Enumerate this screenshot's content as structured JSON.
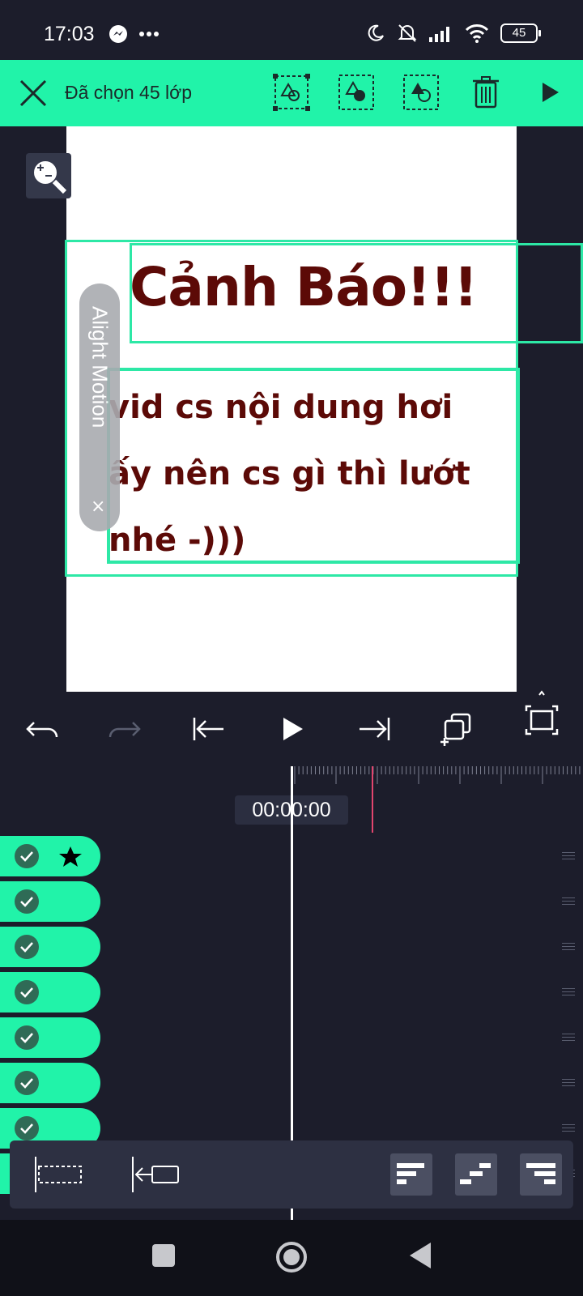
{
  "status_bar": {
    "time": "17:03",
    "battery": "45"
  },
  "toolbar": {
    "title": "Đã chọn 45 lớp"
  },
  "canvas": {
    "title_text": "Cảnh Báo!!!",
    "body_lines": [
      "vid cs nội dung hơi",
      "ấy nên cs gì thì lướt",
      "nhé -)))"
    ],
    "watermark": "Alight Motion",
    "watermark_close": "×"
  },
  "timeline": {
    "timecode": "00:00:00",
    "layers": [
      {
        "checked": true,
        "star": true
      },
      {
        "checked": true
      },
      {
        "checked": true
      },
      {
        "checked": true
      },
      {
        "checked": true
      },
      {
        "checked": true
      },
      {
        "checked": true
      },
      {
        "checked": true
      }
    ]
  },
  "colors": {
    "accent": "#21f3a9",
    "background": "#1c1d2b",
    "text_dark_red": "#5c0a07",
    "marker": "#e2456e"
  }
}
